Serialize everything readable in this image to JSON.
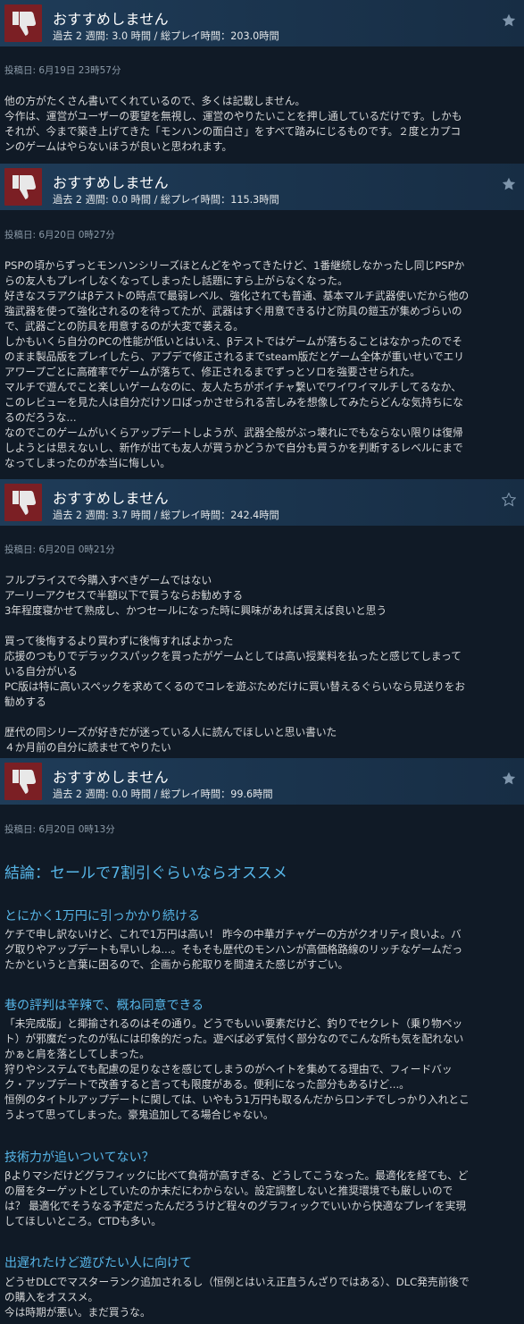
{
  "reviews": [
    {
      "recommendation": "おすすめしません",
      "hours": "過去 2 週間: 3.0 時間 / 総プレイ時間：203.0時間",
      "posted": "投稿日: 6月19日 23時57分",
      "body": "他の方がたくさん書いてくれているので、多くは記載しません。\n今作は、運営がユーザーの要望を無視し、運営のやりたいことを押し通しているだけです。しかも\nそれが、今まで築き上げてきた「モンハンの面白さ」をすべて踏みにじるものです。２度とカプコ\nンのゲームはやらないほうが良いと思われます。",
      "star_filled": true
    },
    {
      "recommendation": "おすすめしません",
      "hours": "過去 2 週間: 0.0 時間 / 総プレイ時間：115.3時間",
      "posted": "投稿日: 6月20日 0時27分",
      "body": "PSPの頃からずっとモンハンシリーズほとんどをやってきたけど、1番継続しなかったし同じPSPか\nらの友人もプレイしなくなってしまったし話題にすら上がらなくなった。\n好きなスラアクはβテストの時点で最弱レベル、強化されても普通、基本マルチ武器使いだから他の\n強武器を使って強化されるのを待ってたが、武器はすぐ用意できるけど防具の鎧玉が集めづらいの\nで、武器ごとの防具を用意するのが大変で萎える。\nしかもいくら自分のPCの性能が低いとはいえ、βテストではゲームが落ちることはなかったのでそ\nのまま製品版をプレイしたら、アプデで修正されるまでsteam版だとゲーム全体が重いせいでエリ\nアワープごとに高確率でゲームが落ちて、修正されるまでずっとソロを強要させられた。\nマルチで遊んでこと楽しいゲームなのに、友人たちがボイチャ繋いでワイワイマルチしてるなか、\nこのレビューを見た人は自分だけソロばっかさせられる苦しみを想像してみたらどんな気持ちにな\nるのだろうな...\nなのでこのゲームがいくらアップデートしようが、武器全般がぶっ壊れにでもならない限りは復帰\nしようとは思えないし、新作が出ても友人が買うかどうかで自分も買うかを判断するレベルにまで\nなってしまったのが本当に悔しい。",
      "star_filled": true
    },
    {
      "recommendation": "おすすめしません",
      "hours": "過去 2 週間: 3.7 時間 / 総プレイ時間：242.4時間",
      "posted": "投稿日: 6月20日 0時21分",
      "body": "フルプライスで今購入すべきゲームではない\nアーリーアクセスで半額以下で買うならお勧めする\n3年程度寝かせて熟成し、かつセールになった時に興味があれば買えば良いと思う\n\n買って後悔するより買わずに後悔すればよかった\n応援のつもりでデラックスパックを買ったがゲームとしては高い授業料を払ったと感じてしまって\nいる自分がいる\nPC版は特に高いスペックを求めてくるのでコレを遊ぶためだけに買い替えるぐらいなら見送りをお\n勧めする\n\n歴代の同シリーズが好きだが迷っている人に読んでほしいと思い書いた\n４か月前の自分に読ませてやりたい",
      "star_filled": false
    },
    {
      "recommendation": "おすすめしません",
      "hours": "過去 2 週間: 0.0 時間 / 総プレイ時間：99.6時間",
      "posted": "投稿日: 6月20日 0時13分",
      "star_filled": true,
      "heading": "結論：セールで7割引ぐらいならオススメ",
      "sections": [
        {
          "title": "とにかく1万円に引っかかり続ける",
          "body": "ケチで申し訳ないけど、これで1万円は高い！ 昨今の中華ガチャゲーの方がクオリティ良いよ。バ\nグ取りやアップデートも早いしね...。そもそも歴代のモンハンが高価格路線のリッチなゲームだっ\nたかというと言葉に困るので、企画から舵取りを間違えた感じがすごい。"
        },
        {
          "title": "巷の評判は辛辣で、概ね同意できる",
          "body": "「未完成版」と揶揄されるのはその通り。どうでもいい要素だけど、釣りでセクレト（乗り物ペッ\nト）が邪魔だったのが私には印象的だった。遊べば必ず気付く部分なのでこんな所も気を配れない\nかぁと肩を落としてしまった。\n狩りやシステムでも配慮の足りなさを感じてしまうのがヘイトを集めてる理由で、フィードバッ\nク・アップデートで改善すると言っても限度がある。便利になった部分もあるけど...。\n恒例のタイトルアップデートに関しては、いやもう1万円も取るんだからロンチでしっかり入れとこ\nうよって思ってしまった。豪鬼追加してる場合じゃない。"
        },
        {
          "title": "技術力が追いついてない？",
          "body": "βよりマシだけどグラフィックに比べて負荷が高すぎる、どうしてこうなった。最適化を経ても、ど\nの層をターゲットとしていたのか未だにわからない。設定調整しないと推奨環境でも厳しいので\nは？ 最適化でそうなる予定だったんだろうけど程々のグラフィックでいいから快適なプレイを実現\nしてほしいところ。CTDも多い。"
        },
        {
          "title": "出遅れたけど遊びたい人に向けて",
          "body": "どうせDLCでマスターランク追加されるし（恒例とはいえ正直うんざりではある）、DLC発売前後で\nの購入をオススメ。\n今は時期が悪い。まだ買うな。"
        }
      ]
    }
  ],
  "colors": {
    "header_bg": "#1b354f",
    "thumb_bg": "#7b1f24",
    "heading": "#57b6e8",
    "body_bg": "#101a26"
  },
  "icons": {
    "thumbs": "thumbs-down-icon",
    "star": "star-icon"
  }
}
